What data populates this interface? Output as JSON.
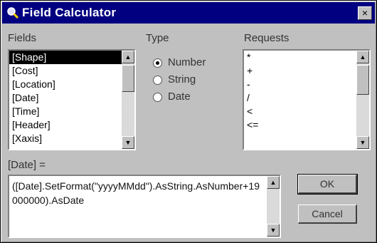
{
  "window": {
    "title": "Field Calculator",
    "close_glyph": "×",
    "title_icon": "calculator-icon"
  },
  "labels": {
    "fields": "Fields",
    "type": "Type",
    "requests": "Requests",
    "target": "[Date] ="
  },
  "fields": {
    "items": [
      "[Shape]",
      "[Cost]",
      "[Location]",
      "[Date]",
      "[Time]",
      "[Header]",
      "[Xaxis]"
    ],
    "selected": "[Shape]"
  },
  "type": {
    "options": [
      "Number",
      "String",
      "Date"
    ],
    "selected": "Number"
  },
  "requests": {
    "items": [
      "*",
      "+",
      "-",
      "/",
      "<",
      "<="
    ]
  },
  "expression": {
    "value": "([Date].SetFormat(\"yyyyMMdd\").AsString.AsNumber+19000000).AsDate"
  },
  "buttons": {
    "ok": "OK",
    "cancel": "Cancel"
  },
  "scroll_glyphs": {
    "up": "▲",
    "down": "▼"
  }
}
